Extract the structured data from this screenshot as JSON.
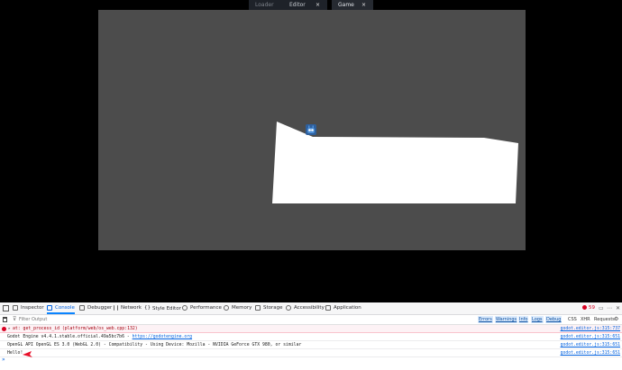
{
  "tabs": [
    {
      "label": "Loader",
      "state": "inactive"
    },
    {
      "label": "Editor",
      "state": "normal",
      "close": "×"
    },
    {
      "label": "Game",
      "state": "active",
      "close": "×"
    }
  ],
  "devtools": {
    "tabs": [
      "Inspector",
      "Console",
      "Debugger",
      "Network",
      "Style Editor",
      "Performance",
      "Memory",
      "Storage",
      "Accessibility",
      "Application"
    ],
    "selected_tab": "Console",
    "error_count": "59",
    "filter_placeholder": "Filter Output",
    "filter_buttons": [
      "Errors",
      "Warnings",
      "Info",
      "Logs",
      "Debug"
    ],
    "right_buttons": [
      "CSS",
      "XHR",
      "Requests"
    ],
    "log_rows": [
      {
        "type": "err",
        "message": "   at: get_process_id (platform/web/os_web.cpp:132)",
        "source": "godot.editor.js:315:737"
      },
      {
        "type": "log",
        "message": "Godot Engine v4.4.1.stable.official.49a5bc7b6 - ",
        "link": "https://godotengine.org",
        "source": "godot.editor.js:315:651"
      },
      {
        "type": "log",
        "message": "OpenGL API OpenGL ES 3.0 (WebGL 2.0) - Compatibility - Using Device: Mozilla - NVIDIA GeForce GTX 980, or similar",
        "source": "godot.editor.js:315:651"
      },
      {
        "type": "log",
        "message": "Hello!",
        "source": "godot.editor.js:315:651"
      }
    ]
  },
  "colors": {
    "viewport_bg": "#4c4c4c",
    "accent": "#0a84ff",
    "error": "#d70022",
    "arrow": "#e8102a"
  }
}
